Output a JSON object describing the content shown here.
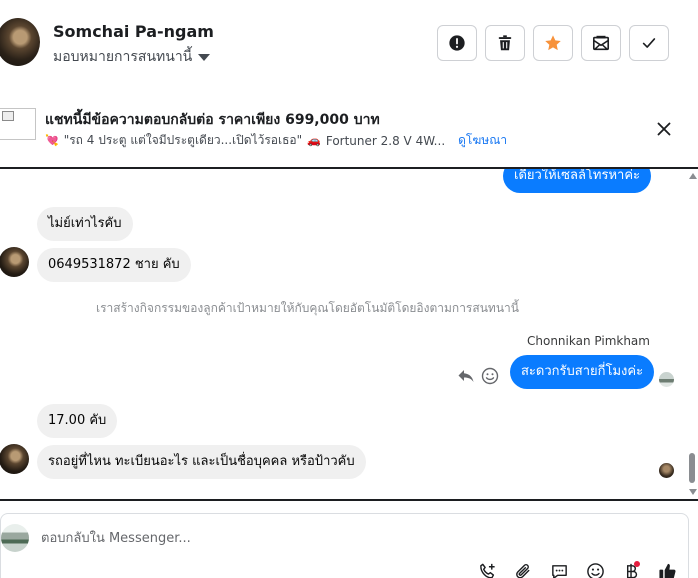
{
  "header": {
    "name": "Somchai Pa-ngam",
    "assign_label": "มอบหมายการสนทนานี้",
    "buttons": [
      {
        "name": "spam-button",
        "icon": "alert-icon"
      },
      {
        "name": "delete-button",
        "icon": "trash-icon"
      },
      {
        "name": "star-button",
        "icon": "star-icon",
        "color": "#f7923b"
      },
      {
        "name": "mark-unread-button",
        "icon": "envelope-icon"
      },
      {
        "name": "done-button",
        "icon": "check-icon"
      }
    ]
  },
  "ad": {
    "title": "แชทนี้มีข้อความตอบกลับต่อ ราคาเพียง 699,000 บาท",
    "subtitle_text": "\"รถ 4 ประตู แต่ใจมีประตูเดียว...เปิดไว้รอเธอ\"",
    "subtitle_car": "Fortuner 2.8 V 4W...",
    "link": "ดูโฆษณา"
  },
  "messages": {
    "m1": "เดี๋ยวให้เซลล์โทรหาค่ะ",
    "m2": "ไม่ย์เท่าไรคับ",
    "m3": "0649531872 ชาย คับ",
    "system": "เราสร้างกิจกรรมของลูกค้าเป้าหมายให้กับคุณโดยอัตโนมัติโดยอิงตามการสนทนานี้",
    "sender": "Chonnikan Pimkham",
    "m4": "สะดวกรับสายกี่โมงค่ะ",
    "m5": "17.00 คับ",
    "m6": "รถอยู่ที่ไหน ทะเบียนอะไร และเป็นชื่อบุคคล หรือป้าวคับ"
  },
  "composer": {
    "placeholder": "ตอบกลับใน Messenger..."
  },
  "colors": {
    "accent": "#0a7cff",
    "incoming": "#f0f0f0",
    "star": "#f7923b",
    "notify_dot": "#e41e3f"
  }
}
